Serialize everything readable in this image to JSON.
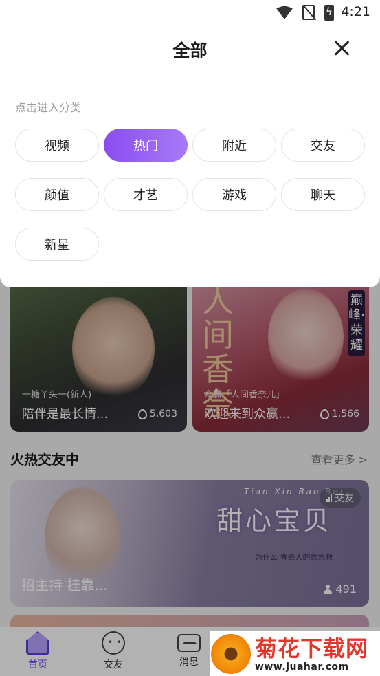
{
  "status_bar": {
    "time": "4:21"
  },
  "sheet": {
    "title": "全部",
    "hint": "点击进入分类",
    "categories": [
      "视频",
      "热门",
      "附近",
      "交友",
      "颜值",
      "才艺",
      "游戏",
      "聊天",
      "新星"
    ],
    "selected": "热门"
  },
  "feed": {
    "cards": [
      {
        "name": "一糖丫头一(新人)",
        "title": "陪伴是最长情...",
        "count": "5,603"
      },
      {
        "name": "众赢「人间香奈儿」",
        "title": "欢迎来到众赢...",
        "count": "1,566",
        "poster_text": "人间香奈",
        "side_text": "巅峰·荣耀"
      }
    ],
    "section_title": "火热交友中",
    "section_more": "查看更多 >",
    "wide_card": {
      "tag": "交友",
      "title": "招主持 挂靠...",
      "count": "491",
      "brand": "甜心宝贝",
      "brand_sub": "Tian Xin Bao Bei",
      "brand_small": "为什么 春去人的靠急救"
    }
  },
  "tabbar": {
    "items": [
      "首页",
      "交友",
      "消息"
    ],
    "active": "首页"
  },
  "watermark": {
    "brand": "菊花下载网",
    "url": "www.juahar.com"
  },
  "colors": {
    "accent": "#8a4cf0",
    "accent_light": "#a77af7"
  }
}
